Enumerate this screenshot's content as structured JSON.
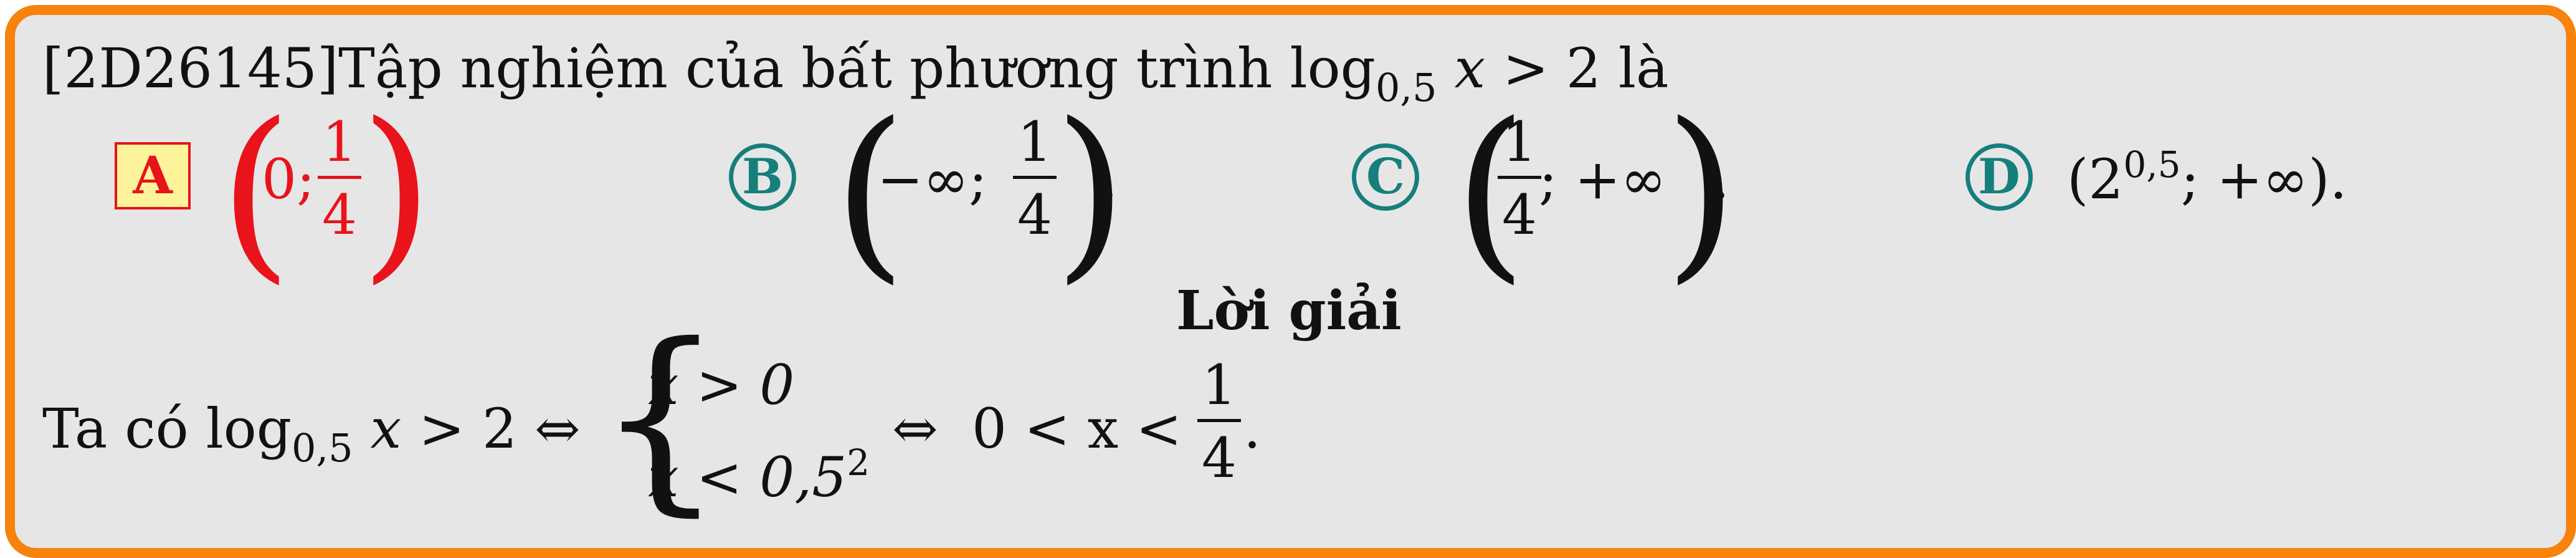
{
  "question": {
    "id": "[2D26145]",
    "text": "Tập nghiệm của bất phương trình",
    "log_word": "log",
    "log_base": "0,5",
    "var": "x",
    "rel": ">",
    "rhs": "2",
    "tail": "là"
  },
  "options": {
    "a": {
      "letter": "A",
      "zero": "0;",
      "num": "1",
      "den": "4",
      "end": "."
    },
    "b": {
      "letter": "B",
      "left": "−∞;",
      "num": "1",
      "den": "4",
      "end": "."
    },
    "c": {
      "letter": "C",
      "num": "1",
      "den": "4",
      "right": "; +∞",
      "end": "."
    },
    "d": {
      "letter": "D",
      "open": "(2",
      "exp": "0,5",
      "rest": "; +∞)."
    }
  },
  "solution": {
    "title": "Lời giải",
    "lead": "Ta có",
    "log_word": "log",
    "log_base": "0,5",
    "var": "x",
    "rel": ">",
    "rhs": "2",
    "iff": "⇔",
    "case1": "x > 0",
    "case2_main": "x < 0,5",
    "case2_exp": "2",
    "iff2": "⇔",
    "ineq": "0 < x <",
    "num": "1",
    "den": "4",
    "end": "."
  },
  "colors": {
    "border": "#f7820c",
    "background": "#e6e6e6",
    "correct": "#e8131b",
    "option": "#157f7c",
    "badge_fill": "#fdf39a"
  }
}
